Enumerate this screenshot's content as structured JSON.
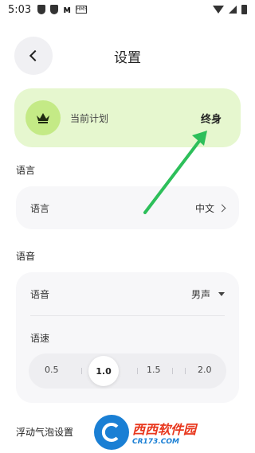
{
  "status_bar": {
    "time": "5:03",
    "sim_label": "HMS"
  },
  "header": {
    "title": "设置"
  },
  "plan": {
    "label": "当前计划",
    "value": "终身"
  },
  "language_section": {
    "title": "语言",
    "row_label": "语言",
    "row_value": "中文"
  },
  "voice_section": {
    "title": "语音",
    "voice_label": "语音",
    "voice_value": "男声",
    "speed_label": "语速",
    "speed_ticks": [
      "0.5",
      "1.0",
      "1.5",
      "2.0"
    ],
    "speed_selected": "1.0"
  },
  "floating_section": {
    "title": "浮动气泡设置"
  },
  "watermark": {
    "title": "西西软件园",
    "sub": "CR173.COM"
  },
  "colors": {
    "plan_bg": "#e6f7cf",
    "crown_bg": "#c4ea86",
    "arrow": "#2dbf5a",
    "card_bg": "#f7f7f9"
  }
}
